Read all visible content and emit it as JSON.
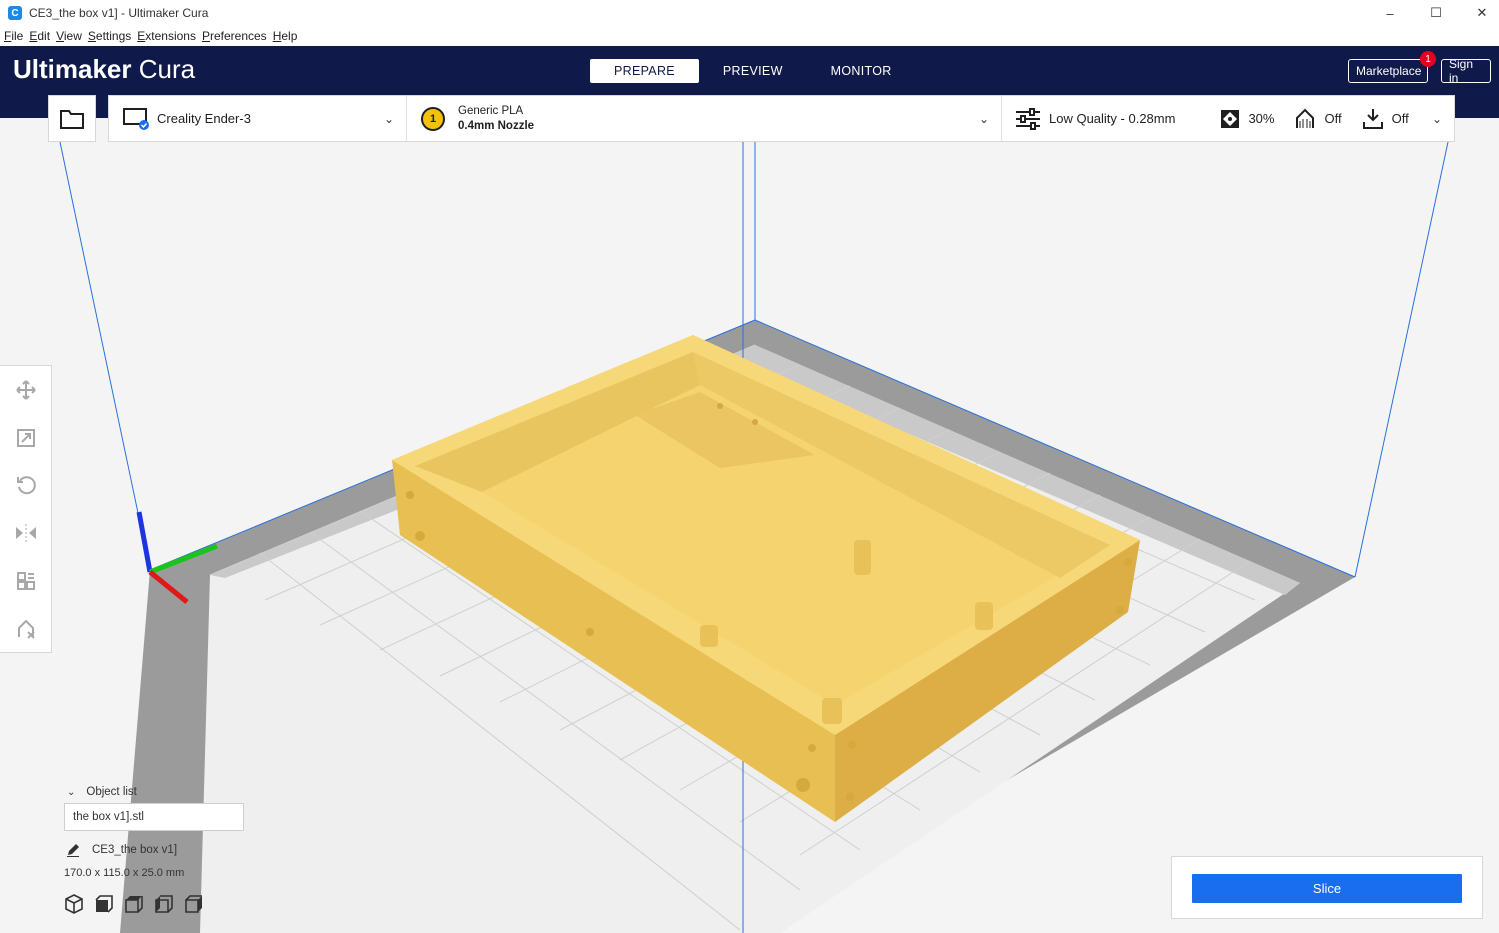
{
  "window": {
    "title": "CE3_the box v1] - Ultimaker Cura",
    "app_icon": "C"
  },
  "menu": [
    "File",
    "Edit",
    "View",
    "Settings",
    "Extensions",
    "Preferences",
    "Help"
  ],
  "header": {
    "logo_bold": "Ultimaker",
    "logo_light": " Cura",
    "stages": [
      "PREPARE",
      "PREVIEW",
      "MONITOR"
    ],
    "active_stage": "PREPARE",
    "marketplace_label": "Marketplace",
    "marketplace_badge": "1",
    "signin_label": "Sign in"
  },
  "config": {
    "printer": "Creality Ender-3",
    "extruder_number": "1",
    "material": "Generic PLA",
    "nozzle": "0.4mm Nozzle",
    "quality": "Low Quality - 0.28mm",
    "infill": "30%",
    "support": "Off",
    "adhesion": "Off"
  },
  "object_panel": {
    "header": "Object list",
    "file": "the box v1].stl",
    "job_name": "CE3_the box v1]",
    "dimensions": "170.0 x 115.0 x 25.0 mm"
  },
  "slice": {
    "label": "Slice"
  },
  "colors": {
    "header": "#0f1a4a",
    "accent": "#196ef0",
    "model": "#f2cf6b",
    "badge": "#e6001e"
  }
}
